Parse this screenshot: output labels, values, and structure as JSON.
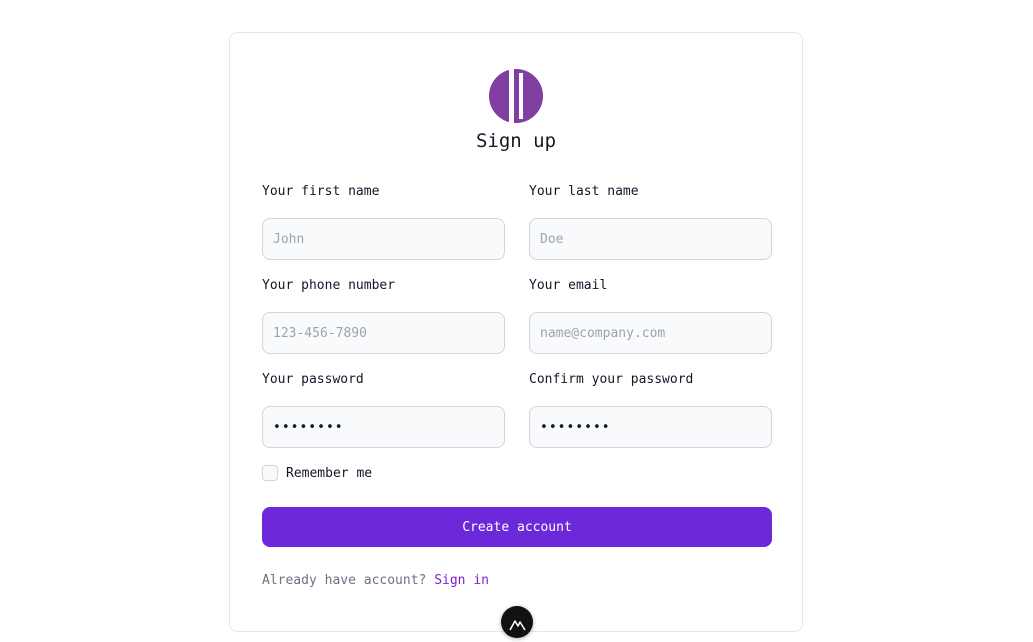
{
  "form": {
    "title": "Sign up",
    "first_name": {
      "label": "Your first name",
      "placeholder": "John"
    },
    "last_name": {
      "label": "Your last name",
      "placeholder": "Doe"
    },
    "phone": {
      "label": "Your phone number",
      "placeholder": "123-456-7890"
    },
    "email": {
      "label": "Your email",
      "placeholder": "name@company.com"
    },
    "password": {
      "label": "Your password",
      "placeholder": "••••••••"
    },
    "confirm_password": {
      "label": "Confirm your password",
      "placeholder": "••••••••"
    },
    "remember_label": "Remember me",
    "submit_label": "Create account",
    "signin_prompt": "Already have account?",
    "signin_link": "Sign in"
  },
  "colors": {
    "brand": "#7e3fa0",
    "primary_button": "#6d28d9",
    "link": "#7e22ce"
  },
  "icons": {
    "logo": "brand-logo-icon",
    "floating": "mountain-logo-icon"
  }
}
